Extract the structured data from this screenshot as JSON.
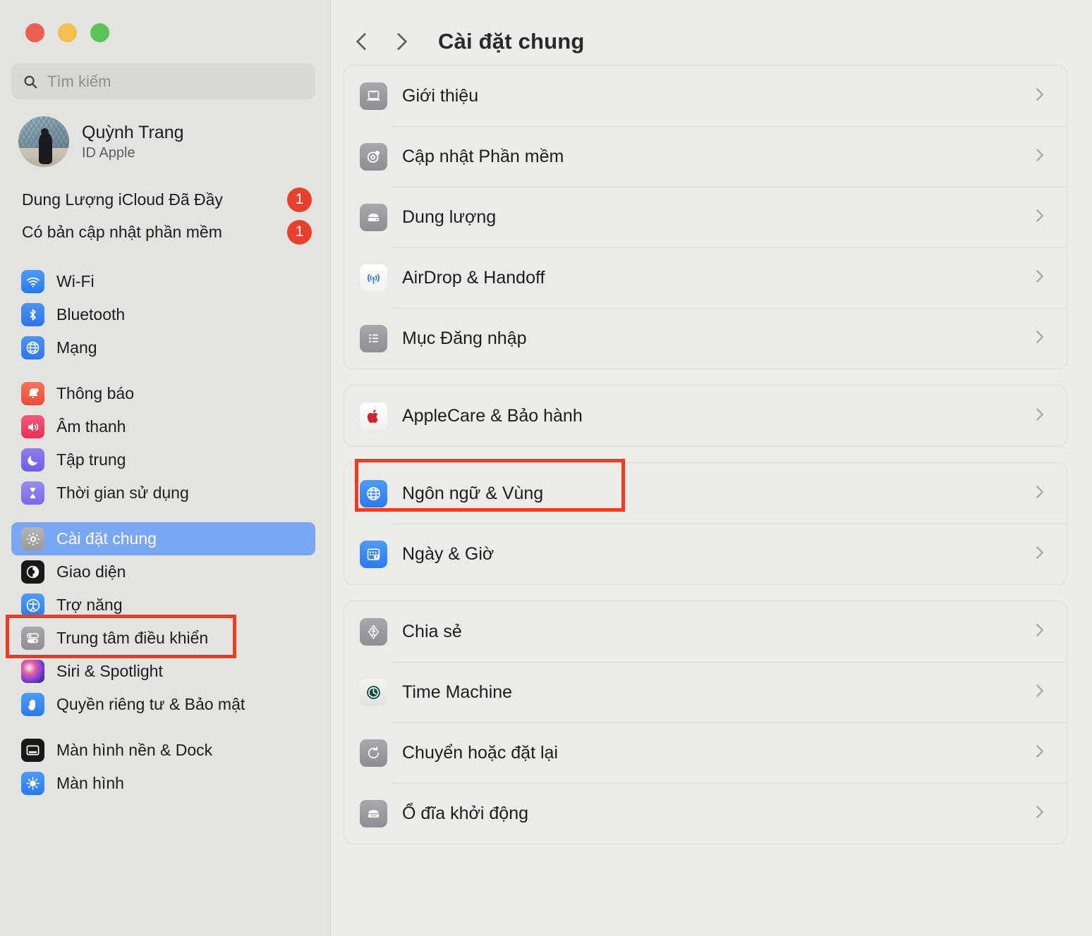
{
  "window": {
    "traffic_lights": [
      "close",
      "minimize",
      "maximize"
    ]
  },
  "sidebar": {
    "search": {
      "placeholder": "Tìm kiếm",
      "value": "",
      "icon": "search-icon"
    },
    "account": {
      "name": "Quỳnh Trang",
      "subtitle": "ID Apple",
      "avatar": "user-avatar"
    },
    "alerts": [
      {
        "label": "Dung Lượng iCloud Đã Đầy",
        "badge": "1"
      },
      {
        "label": "Có bản cập nhật phần mềm",
        "badge": "1"
      }
    ],
    "groups": [
      {
        "items": [
          {
            "label": "Wi-Fi",
            "icon": "wifi-icon"
          },
          {
            "label": "Bluetooth",
            "icon": "bluetooth-icon"
          },
          {
            "label": "Mạng",
            "icon": "network-globe-icon"
          }
        ]
      },
      {
        "items": [
          {
            "label": "Thông báo",
            "icon": "notifications-bell-icon"
          },
          {
            "label": "Âm thanh",
            "icon": "sound-speaker-icon"
          },
          {
            "label": "Tập trung",
            "icon": "focus-moon-icon"
          },
          {
            "label": "Thời gian sử dụng",
            "icon": "screen-time-hourglass-icon"
          }
        ]
      },
      {
        "items": [
          {
            "label": "Cài đặt chung",
            "icon": "general-gear-icon",
            "selected": true
          },
          {
            "label": "Giao diện",
            "icon": "appearance-contrast-icon"
          },
          {
            "label": "Trợ năng",
            "icon": "accessibility-icon"
          },
          {
            "label": "Trung tâm điều khiển",
            "icon": "control-center-toggles-icon"
          },
          {
            "label": "Siri & Spotlight",
            "icon": "siri-orb-icon"
          },
          {
            "label": "Quyền riêng tư & Bảo mật",
            "icon": "privacy-hand-icon"
          }
        ]
      },
      {
        "items": [
          {
            "label": "Màn hình nền & Dock",
            "icon": "desktop-dock-icon"
          },
          {
            "label": "Màn hình",
            "icon": "displays-brightness-icon"
          }
        ]
      }
    ]
  },
  "main": {
    "nav": {
      "back": "chevron-left-icon",
      "forward": "chevron-right-icon"
    },
    "title": "Cài đặt chung",
    "sections": [
      {
        "rows": [
          {
            "label": "Giới thiệu",
            "icon": "about-laptop-icon",
            "chevron": "chevron-right-icon"
          },
          {
            "label": "Cập nhật Phần mềm",
            "icon": "software-update-gear-icon",
            "chevron": "chevron-right-icon"
          },
          {
            "label": "Dung lượng",
            "icon": "storage-disk-icon",
            "chevron": "chevron-right-icon"
          },
          {
            "label": "AirDrop & Handoff",
            "icon": "airdrop-icon",
            "chevron": "chevron-right-icon"
          },
          {
            "label": "Mục Đăng nhập",
            "icon": "login-items-list-icon",
            "chevron": "chevron-right-icon"
          }
        ]
      },
      {
        "rows": [
          {
            "label": "AppleCare & Bảo hành",
            "icon": "apple-logo-icon",
            "chevron": "chevron-right-icon"
          }
        ]
      },
      {
        "rows": [
          {
            "label": "Ngôn ngữ & Vùng",
            "icon": "language-region-globe-icon",
            "chevron": "chevron-right-icon",
            "highlighted": true
          },
          {
            "label": "Ngày & Giờ",
            "icon": "date-time-calendar-icon",
            "chevron": "chevron-right-icon"
          }
        ]
      },
      {
        "rows": [
          {
            "label": "Chia sẻ",
            "icon": "sharing-icon",
            "chevron": "chevron-right-icon"
          },
          {
            "label": "Time Machine",
            "icon": "time-machine-icon",
            "chevron": "chevron-right-icon"
          },
          {
            "label": "Chuyển hoặc đặt lại",
            "icon": "transfer-reset-icon",
            "chevron": "chevron-right-icon"
          },
          {
            "label": "Ổ đĩa khởi động",
            "icon": "startup-disk-icon",
            "chevron": "chevron-right-icon"
          }
        ]
      }
    ]
  },
  "annotations": {
    "colors": {
      "highlight_box": "#ee3b22",
      "selection": "#7aa7f5",
      "badge": "#e8402f"
    },
    "boxes": [
      {
        "target": "sidebar-item-cai-dat-chung"
      },
      {
        "target": "row-ngon-ngu-vung"
      }
    ]
  }
}
